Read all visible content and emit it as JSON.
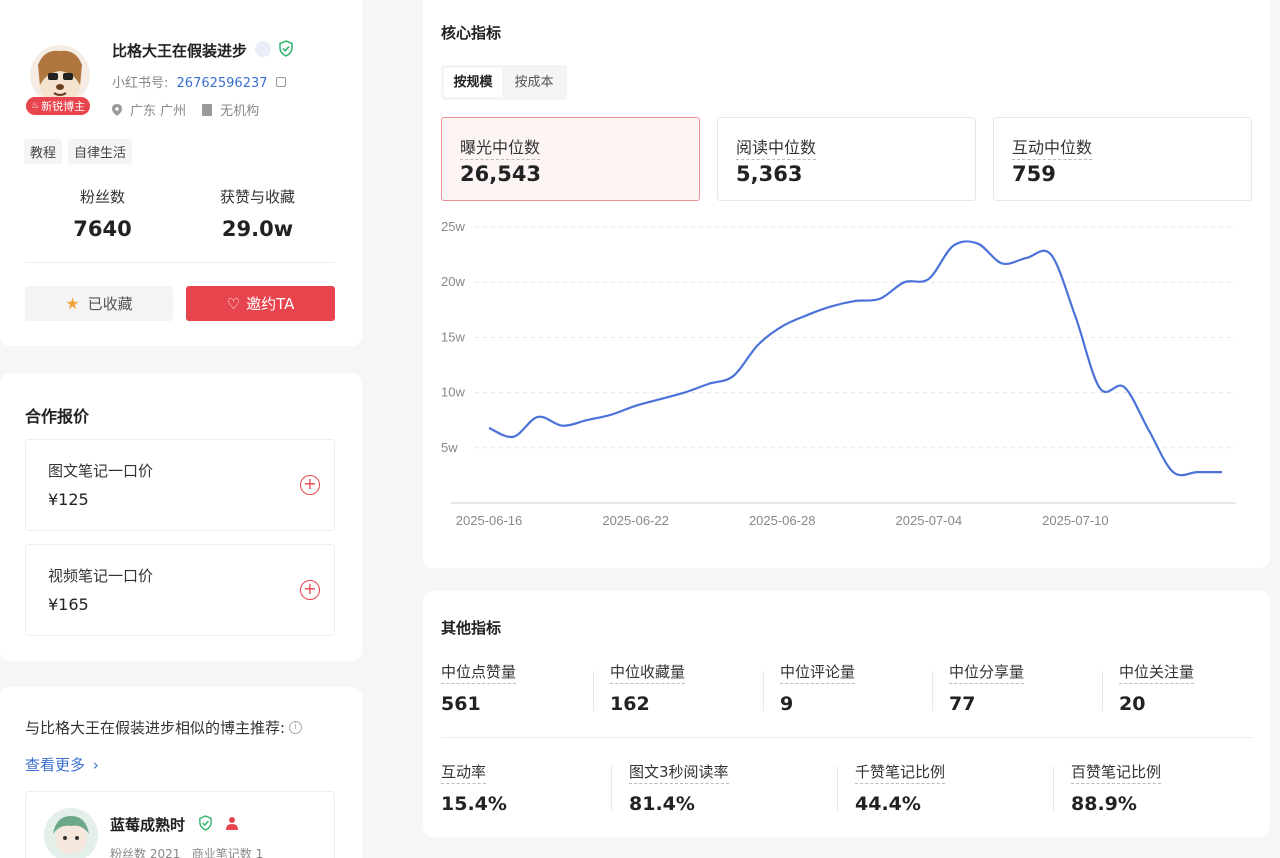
{
  "profile": {
    "name": "比格大王在假装进步",
    "badge": "新锐博主",
    "id_label": "小红书号:",
    "id_value": "26762596237",
    "location": "广东 广州",
    "org": "无机构",
    "tags": [
      "教程",
      "自律生活"
    ],
    "fans_label": "粉丝数",
    "fans_value": "7640",
    "likes_label": "获赞与收藏",
    "likes_value": "29.0w",
    "collected_label": "已收藏",
    "invite_label": "邀约TA"
  },
  "pricing": {
    "title": "合作报价",
    "items": [
      {
        "label": "图文笔记一口价",
        "price": "¥125"
      },
      {
        "label": "视频笔记一口价",
        "price": "¥165"
      }
    ]
  },
  "similar": {
    "title": "与比格大王在假装进步相似的博主推荐:",
    "more": "查看更多",
    "item": {
      "name": "蓝莓成熟时",
      "stats": "粉丝数 2021   商业笔记数 1"
    }
  },
  "core": {
    "title": "核心指标",
    "tabs": [
      "按规模",
      "按成本"
    ],
    "active_tab": 0,
    "metrics": [
      {
        "label": "曝光中位数",
        "value": "26,543"
      },
      {
        "label": "阅读中位数",
        "value": "5,363"
      },
      {
        "label": "互动中位数",
        "value": "759"
      }
    ]
  },
  "chart_data": {
    "type": "line",
    "ylim": [
      0,
      25
    ],
    "y_ticks": [
      {
        "v": 5,
        "label": "5w"
      },
      {
        "v": 10,
        "label": "10w"
      },
      {
        "v": 15,
        "label": "15w"
      },
      {
        "v": 20,
        "label": "20w"
      },
      {
        "v": 25,
        "label": "25w"
      }
    ],
    "x_ticks": [
      "2025-06-16",
      "2025-06-22",
      "2025-06-28",
      "2025-07-04",
      "2025-07-10"
    ],
    "x": [
      "2025-06-16",
      "2025-06-17",
      "2025-06-18",
      "2025-06-19",
      "2025-06-20",
      "2025-06-21",
      "2025-06-22",
      "2025-06-23",
      "2025-06-24",
      "2025-06-25",
      "2025-06-26",
      "2025-06-27",
      "2025-06-28",
      "2025-06-29",
      "2025-06-30",
      "2025-07-01",
      "2025-07-02",
      "2025-07-03",
      "2025-07-04",
      "2025-07-05",
      "2025-07-06",
      "2025-07-07",
      "2025-07-08",
      "2025-07-09",
      "2025-07-10",
      "2025-07-11",
      "2025-07-12",
      "2025-07-13",
      "2025-07-14",
      "2025-07-15",
      "2025-07-16"
    ],
    "series": [
      {
        "color": "#4a72d9",
        "values": [
          6.8,
          6.0,
          7.8,
          7.0,
          7.5,
          8.0,
          8.8,
          9.4,
          10.0,
          10.8,
          11.5,
          14.3,
          16.0,
          17.0,
          17.8,
          18.3,
          18.5,
          20.0,
          20.3,
          23.3,
          23.5,
          21.7,
          22.2,
          22.5,
          16.9,
          10.4,
          10.5,
          6.6,
          2.8,
          2.8,
          2.8
        ]
      }
    ]
  },
  "other": {
    "title": "其他指标",
    "row1": [
      {
        "label": "中位点赞量",
        "value": "561"
      },
      {
        "label": "中位收藏量",
        "value": "162"
      },
      {
        "label": "中位评论量",
        "value": "9"
      },
      {
        "label": "中位分享量",
        "value": "77"
      },
      {
        "label": "中位关注量",
        "value": "20"
      }
    ],
    "row2": [
      {
        "label": "互动率",
        "value": "15.4%"
      },
      {
        "label": "图文3秒阅读率",
        "value": "81.4%"
      },
      {
        "label": "千赞笔记比例",
        "value": "44.4%"
      },
      {
        "label": "百赞笔记比例",
        "value": "88.9%"
      }
    ]
  }
}
